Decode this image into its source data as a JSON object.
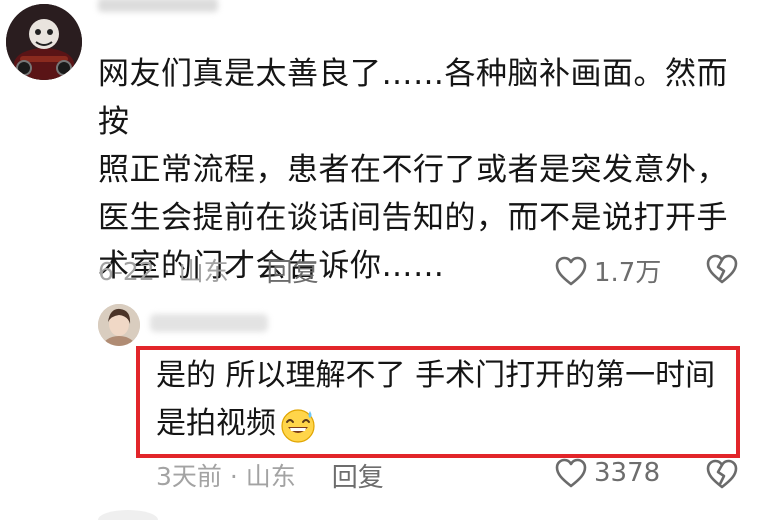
{
  "comments": [
    {
      "text": "网友们真是太善良了……各种脑补画面。然而按\n照正常流程，患者在不行了或者是突发意外，\n医生会提前在谈话间告知的，而不是说打开手\n术室的门才会告诉你……",
      "meta": "6-22 · 山东",
      "reply_label": "回复",
      "likes": "1.7万"
    },
    {
      "text": "是的 所以理解不了 手术门打开的第一时间\n是拍视频",
      "meta": "3天前 · 山东",
      "reply_label": "回复",
      "likes": "3378",
      "emoji": "sweat-smile-emoji"
    }
  ],
  "icons": {
    "like": "heart-outline-icon",
    "dislike": "broken-heart-icon"
  },
  "colors": {
    "highlight_border": "#e2252a",
    "text": "#151515",
    "meta": "#a3a3a3"
  }
}
